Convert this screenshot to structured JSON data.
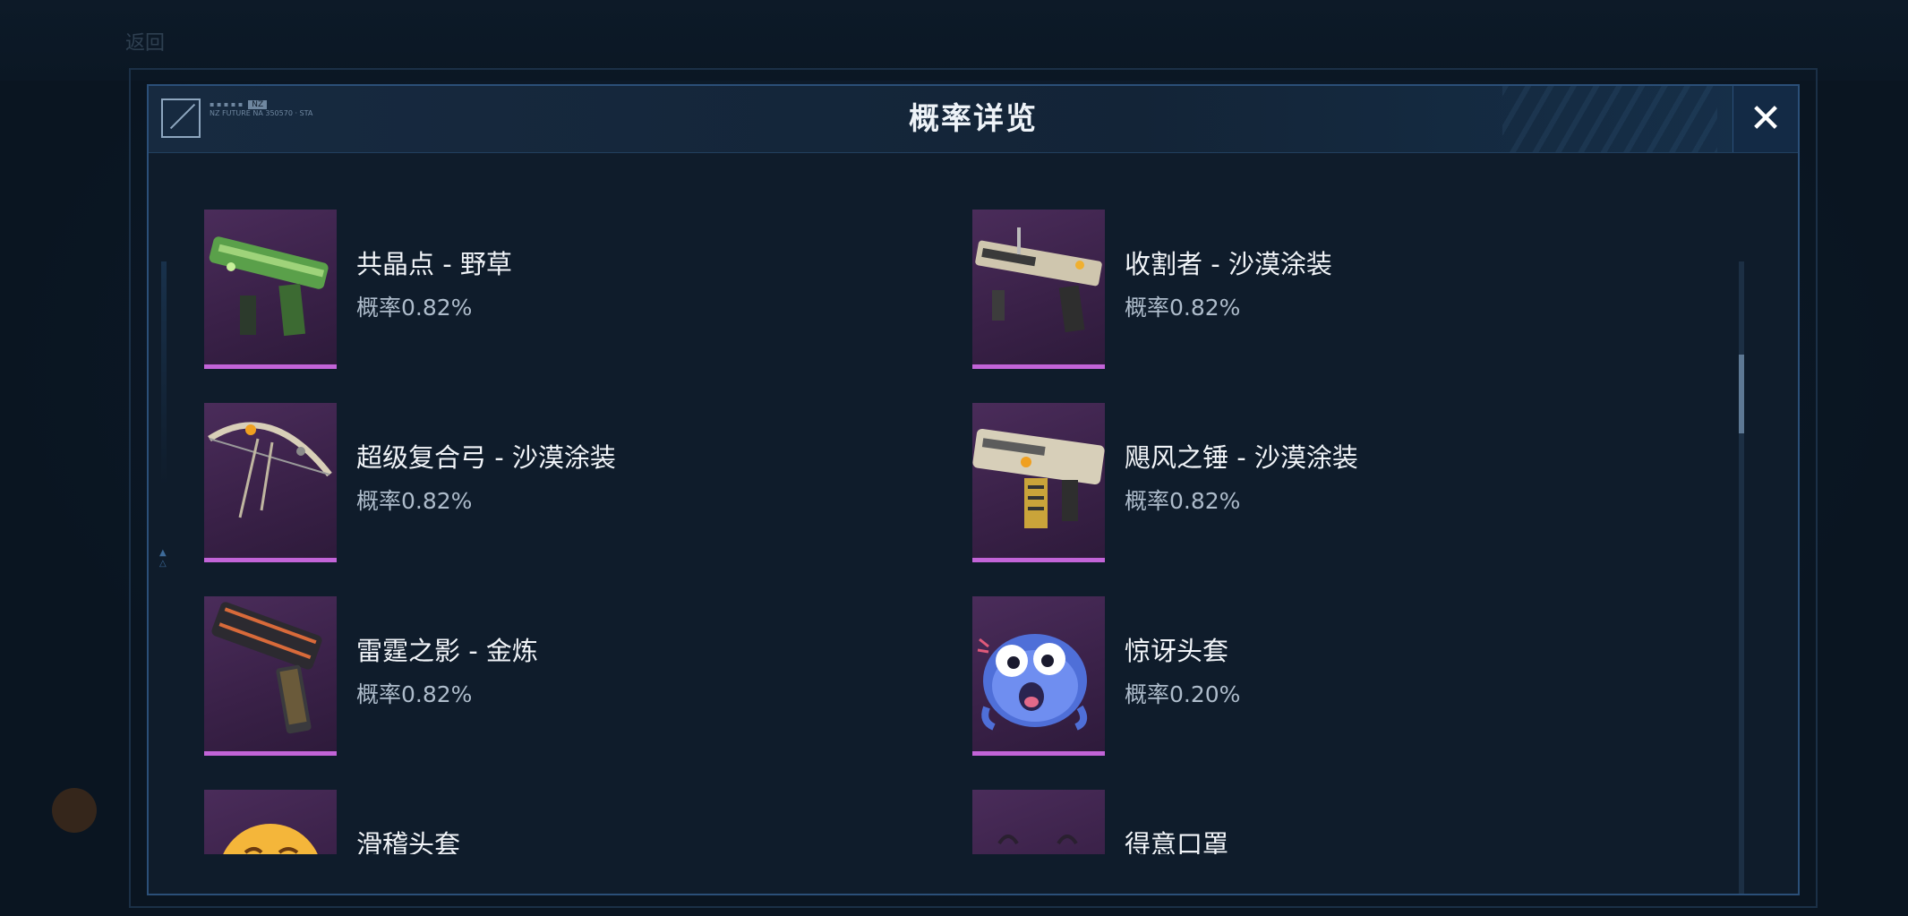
{
  "background": {
    "back_label": "返回",
    "logo_tag": "NZ",
    "logo_line1": "NZ FUTURE NA 350570 · STA"
  },
  "modal": {
    "title": "概率详览",
    "close_icon": "close-icon"
  },
  "items": [
    {
      "name": "共晶点 - 野草",
      "prob": "概率0.82%",
      "icon": "smg-green-icon"
    },
    {
      "name": "收割者 - 沙漠涂装",
      "prob": "概率0.82%",
      "icon": "rifle-desert-icon"
    },
    {
      "name": "超级复合弓 - 沙漠涂装",
      "prob": "概率0.82%",
      "icon": "bow-desert-icon"
    },
    {
      "name": "飓风之锤 - 沙漠涂装",
      "prob": "概率0.82%",
      "icon": "launcher-desert-icon"
    },
    {
      "name": "雷霆之影 - 金炼",
      "prob": "概率0.82%",
      "icon": "pistol-gold-icon"
    },
    {
      "name": "惊讶头套",
      "prob": "概率0.20%",
      "icon": "surprised-mask-icon"
    },
    {
      "name": "滑稽头套",
      "prob": "",
      "icon": "funny-mask-icon"
    },
    {
      "name": "得意口罩",
      "prob": "",
      "icon": "smug-mask-icon"
    }
  ],
  "colors": {
    "accent": "#c264d8",
    "modal_border": "#2b4f78",
    "title": "#eef3f8"
  }
}
